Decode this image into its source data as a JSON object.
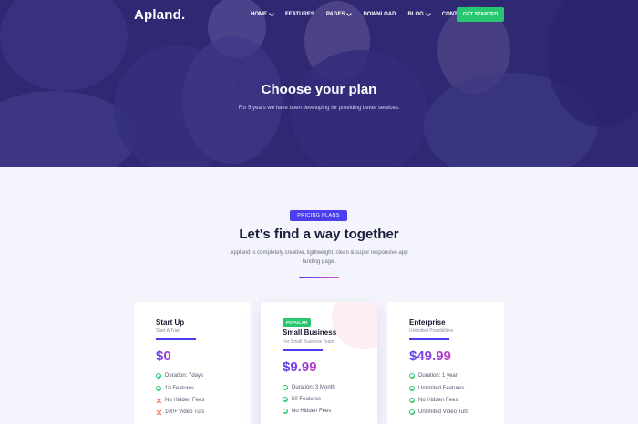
{
  "nav": {
    "logo": "Apland.",
    "items": [
      {
        "label": "HOME",
        "dropdown": true
      },
      {
        "label": "FEATURES",
        "dropdown": false
      },
      {
        "label": "PAGES",
        "dropdown": true
      },
      {
        "label": "DOWNLOAD",
        "dropdown": false
      },
      {
        "label": "BLOG",
        "dropdown": true
      },
      {
        "label": "CONTACT",
        "dropdown": false
      }
    ],
    "cta": "GET STARTED"
  },
  "hero": {
    "title": "Choose your plan",
    "subtitle": "For 5 years we have been developing for providing better services."
  },
  "pricing": {
    "badge": "PRICING PLANS",
    "title": "Let's find a way together",
    "description": "Appland is completely creative, lightweight, clean & super responsive app landing page.",
    "plans": [
      {
        "name": "Start Up",
        "tagline": "Start A Trial",
        "price": "$0",
        "popular": "",
        "features": [
          {
            "text": "Duration: 7days",
            "included": true
          },
          {
            "text": "10 Features",
            "included": true
          },
          {
            "text": "No Hidden Fees",
            "included": false
          },
          {
            "text": "100+ Video Tuts",
            "included": false
          }
        ]
      },
      {
        "name": "Small Business",
        "tagline": "For Small Business Team",
        "price": "$9.99",
        "popular": "POPULAR",
        "features": [
          {
            "text": "Duration: 3 Month",
            "included": true
          },
          {
            "text": "50 Features",
            "included": true
          },
          {
            "text": "No Hidden Fees",
            "included": true
          }
        ]
      },
      {
        "name": "Enterprise",
        "tagline": "Unlimited Possibilities",
        "price": "$49.99",
        "popular": "",
        "features": [
          {
            "text": "Duration: 1 year",
            "included": true
          },
          {
            "text": "Unlimited Features",
            "included": true
          },
          {
            "text": "No Hidden Fees",
            "included": true
          },
          {
            "text": "Unlimited Video Tuts",
            "included": true
          }
        ]
      }
    ]
  },
  "colors": {
    "accent": "#4b3df0",
    "success": "#28c76f",
    "danger": "#f2633d",
    "hero_overlay": "#3b338c"
  }
}
